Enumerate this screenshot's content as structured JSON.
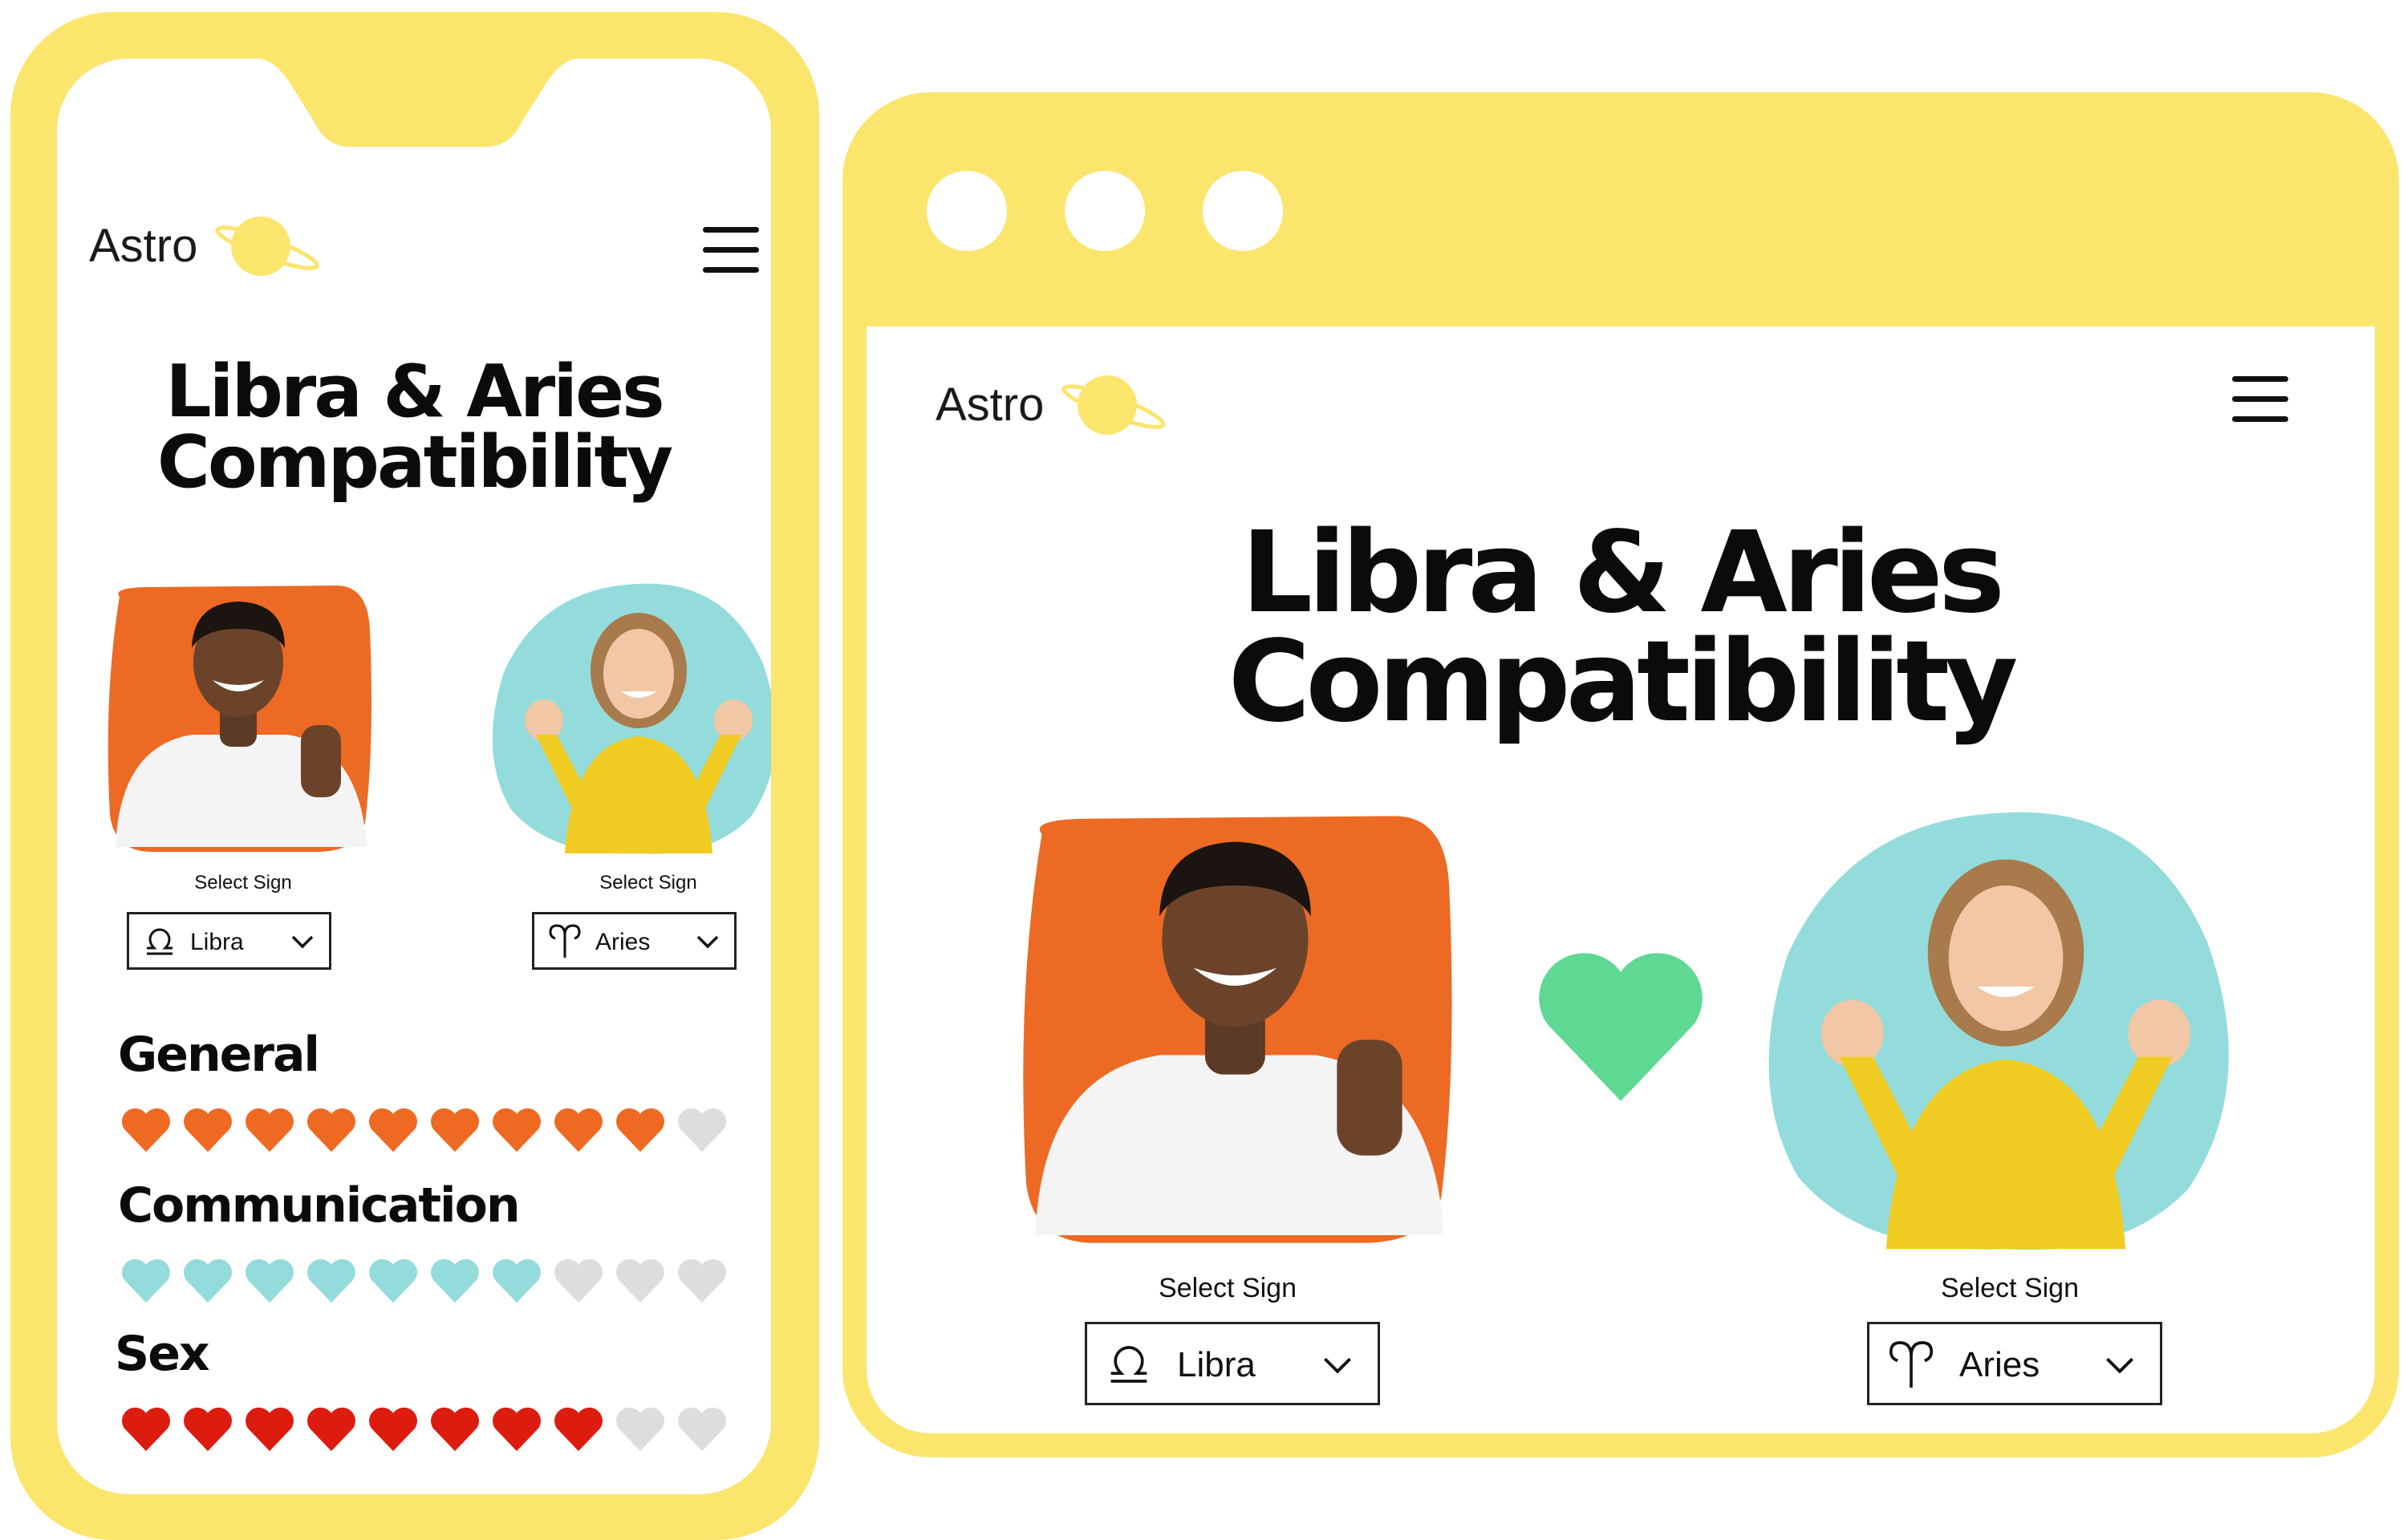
{
  "brand": {
    "name": "Astro"
  },
  "page": {
    "title_line1": "Libra & Aries",
    "title_line2": "Compatibility"
  },
  "match": {
    "left": {
      "label": "Select Sign",
      "sign": "Libra",
      "sign_icon": "libra-icon",
      "photo": "smiling-man-thumbs-up"
    },
    "right": {
      "label": "Select Sign",
      "sign": "Aries",
      "sign_icon": "aries-icon",
      "photo": "excited-woman-yellow-sweater"
    },
    "match_icon": "heart-icon"
  },
  "categories": [
    {
      "name": "General",
      "score": 9,
      "max": 10,
      "color": "#ee6a22"
    },
    {
      "name": "Communication",
      "score": 7,
      "max": 10,
      "color": "#94dcdb"
    },
    {
      "name": "Sex",
      "score": 8,
      "max": 10,
      "color": "#dd1c10"
    }
  ],
  "colors": {
    "frame": "#fbe56d",
    "planet": "#fbe56d",
    "match_heart": "#5fd894",
    "empty_heart": "#dddddd",
    "avatar_left_bg": "#ec6a24",
    "avatar_right_bg": "#94dcdb"
  },
  "window_controls": [
    "window-dot",
    "window-dot",
    "window-dot"
  ]
}
